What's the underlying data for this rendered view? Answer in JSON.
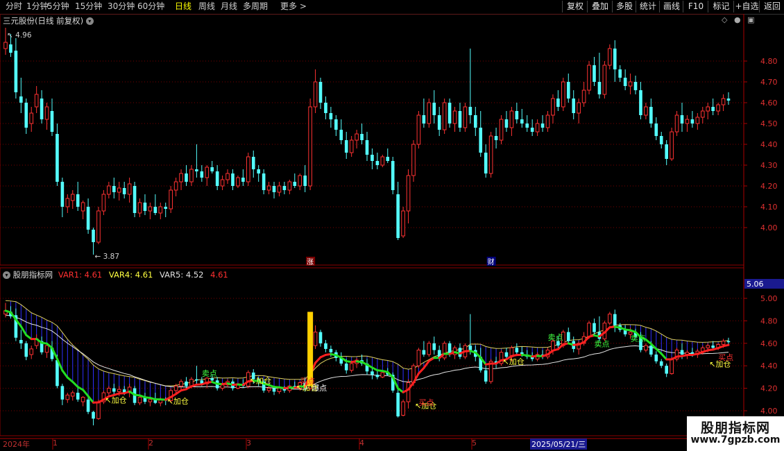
{
  "toolbar": {
    "left_items": [
      "分时",
      "1分钟",
      "5分钟",
      "15分钟",
      "30分钟",
      "60分钟",
      "日线",
      "周线",
      "月线",
      "多周期",
      "更多 >"
    ],
    "selected": "日线",
    "right_items": [
      "复权",
      "叠加",
      "多股",
      "统计",
      "画线",
      "F10",
      "标记",
      "+自选",
      "返回"
    ]
  },
  "main_panel": {
    "title": "三元股份(日线 前复权)",
    "high_marker": "4.96",
    "low_marker": "3.87",
    "y_ticks": [
      "4.80",
      "4.70",
      "4.60",
      "4.50",
      "4.40",
      "4.30",
      "4.20",
      "4.10",
      "4.00"
    ],
    "tags": {
      "zhang": "涨",
      "cai": "财"
    }
  },
  "indicator_panel": {
    "name": "股朋指标网",
    "var1": "VAR1: 4.61",
    "var4": "VAR4: 4.61",
    "var5": "VAR5: 4.52",
    "extra": "4.61",
    "y_ticks": [
      "5.00",
      "4.80",
      "4.60",
      "4.40",
      "4.20",
      "4.00"
    ],
    "current_value": "5.06",
    "signals": {
      "add": "加仓",
      "sell": "卖点",
      "buy": "买点",
      "burst": "爆点"
    }
  },
  "date_axis": {
    "labels": [
      "2024年",
      "1",
      "2",
      "3",
      "4",
      "5"
    ],
    "cursor_date": "2025/05/21/三"
  },
  "watermark": {
    "line1": "股朋指标网",
    "line2": "www.7gpzb.com"
  },
  "colors": {
    "up": "#ff3232",
    "down": "#54ffff",
    "red_line": "#ff2020",
    "green_line": "#22dd22",
    "fill_blue": "#3030ff",
    "grid": "#7a0000"
  },
  "chart_data": {
    "type": "candlestick",
    "ohlc": [
      [
        4.86,
        4.96,
        4.83,
        4.89
      ],
      [
        4.88,
        4.93,
        4.82,
        4.84
      ],
      [
        4.85,
        4.91,
        4.62,
        4.65
      ],
      [
        4.63,
        4.72,
        4.55,
        4.6
      ],
      [
        4.6,
        4.62,
        4.45,
        4.48
      ],
      [
        4.5,
        4.58,
        4.46,
        4.55
      ],
      [
        4.58,
        4.68,
        4.55,
        4.64
      ],
      [
        4.62,
        4.66,
        4.5,
        4.52
      ],
      [
        4.52,
        4.6,
        4.47,
        4.58
      ],
      [
        4.56,
        4.62,
        4.44,
        4.46
      ],
      [
        4.45,
        4.5,
        4.2,
        4.22
      ],
      [
        4.22,
        4.24,
        4.05,
        4.1
      ],
      [
        4.1,
        4.16,
        4.07,
        4.14
      ],
      [
        4.13,
        4.18,
        4.09,
        4.16
      ],
      [
        4.16,
        4.22,
        4.08,
        4.1
      ],
      [
        4.08,
        4.13,
        4.04,
        4.12
      ],
      [
        4.1,
        4.14,
        3.97,
        3.99
      ],
      [
        3.99,
        4.0,
        3.87,
        3.93
      ],
      [
        3.93,
        4.1,
        3.92,
        4.08
      ],
      [
        4.08,
        4.18,
        4.06,
        4.16
      ],
      [
        4.16,
        4.22,
        4.14,
        4.2
      ],
      [
        4.2,
        4.24,
        4.14,
        4.17
      ],
      [
        4.17,
        4.22,
        4.13,
        4.19
      ],
      [
        4.19,
        4.22,
        4.14,
        4.16
      ],
      [
        4.16,
        4.24,
        4.12,
        4.21
      ],
      [
        4.2,
        4.22,
        4.05,
        4.07
      ],
      [
        4.07,
        4.14,
        4.05,
        4.12
      ],
      [
        4.12,
        4.16,
        4.06,
        4.08
      ],
      [
        4.08,
        4.12,
        4.04,
        4.1
      ],
      [
        4.1,
        4.16,
        4.06,
        4.07
      ],
      [
        4.07,
        4.12,
        4.04,
        4.1
      ],
      [
        4.1,
        4.12,
        4.05,
        4.09
      ],
      [
        4.09,
        4.2,
        4.07,
        4.18
      ],
      [
        4.18,
        4.24,
        4.15,
        4.22
      ],
      [
        4.22,
        4.28,
        4.18,
        4.26
      ],
      [
        4.26,
        4.3,
        4.2,
        4.22
      ],
      [
        4.22,
        4.3,
        4.2,
        4.28
      ],
      [
        4.28,
        4.4,
        4.24,
        4.27
      ],
      [
        4.27,
        4.3,
        4.22,
        4.24
      ],
      [
        4.24,
        4.3,
        4.2,
        4.29
      ],
      [
        4.29,
        4.32,
        4.26,
        4.27
      ],
      [
        4.27,
        4.3,
        4.18,
        4.2
      ],
      [
        4.2,
        4.25,
        4.18,
        4.23
      ],
      [
        4.23,
        4.28,
        4.21,
        4.26
      ],
      [
        4.26,
        4.28,
        4.18,
        4.2
      ],
      [
        4.2,
        4.25,
        4.19,
        4.24
      ],
      [
        4.24,
        4.28,
        4.2,
        4.22
      ],
      [
        4.22,
        4.36,
        4.2,
        4.34
      ],
      [
        4.34,
        4.37,
        4.24,
        4.28
      ],
      [
        4.28,
        4.3,
        4.22,
        4.26
      ],
      [
        4.26,
        4.28,
        4.16,
        4.18
      ],
      [
        4.18,
        4.22,
        4.16,
        4.2
      ],
      [
        4.2,
        4.22,
        4.14,
        4.17
      ],
      [
        4.17,
        4.22,
        4.15,
        4.2
      ],
      [
        4.2,
        4.22,
        4.16,
        4.18
      ],
      [
        4.18,
        4.23,
        4.16,
        4.22
      ],
      [
        4.22,
        4.26,
        4.19,
        4.2
      ],
      [
        4.2,
        4.26,
        4.18,
        4.25
      ],
      [
        4.25,
        4.3,
        4.17,
        4.2
      ],
      [
        4.2,
        4.62,
        4.18,
        4.58
      ],
      [
        4.58,
        4.76,
        4.55,
        4.7
      ],
      [
        4.7,
        4.72,
        4.57,
        4.6
      ],
      [
        4.6,
        4.63,
        4.52,
        4.55
      ],
      [
        4.55,
        4.58,
        4.48,
        4.52
      ],
      [
        4.52,
        4.54,
        4.44,
        4.47
      ],
      [
        4.47,
        4.52,
        4.4,
        4.42
      ],
      [
        4.42,
        4.46,
        4.33,
        4.36
      ],
      [
        4.36,
        4.44,
        4.34,
        4.42
      ],
      [
        4.42,
        4.47,
        4.38,
        4.45
      ],
      [
        4.45,
        4.5,
        4.4,
        4.42
      ],
      [
        4.42,
        4.46,
        4.32,
        4.35
      ],
      [
        4.35,
        4.38,
        4.28,
        4.32
      ],
      [
        4.32,
        4.36,
        4.28,
        4.3
      ],
      [
        4.3,
        4.35,
        4.29,
        4.34
      ],
      [
        4.34,
        4.38,
        4.31,
        4.32
      ],
      [
        4.32,
        4.34,
        4.16,
        4.18
      ],
      [
        4.16,
        4.22,
        3.94,
        3.95
      ],
      [
        3.96,
        4.1,
        3.95,
        4.08
      ],
      [
        4.08,
        4.28,
        4.02,
        4.25
      ],
      [
        4.25,
        4.42,
        4.22,
        4.4
      ],
      [
        4.4,
        4.56,
        4.38,
        4.54
      ],
      [
        4.54,
        4.62,
        4.48,
        4.5
      ],
      [
        4.5,
        4.62,
        4.48,
        4.6
      ],
      [
        4.6,
        4.66,
        4.5,
        4.54
      ],
      [
        4.54,
        4.58,
        4.44,
        4.47
      ],
      [
        4.47,
        4.62,
        4.45,
        4.6
      ],
      [
        4.6,
        4.62,
        4.48,
        4.5
      ],
      [
        4.5,
        4.58,
        4.46,
        4.56
      ],
      [
        4.56,
        4.6,
        4.46,
        4.48
      ],
      [
        4.48,
        4.6,
        4.46,
        4.58
      ],
      [
        4.58,
        4.86,
        4.5,
        4.54
      ],
      [
        4.54,
        4.58,
        4.44,
        4.48
      ],
      [
        4.48,
        4.56,
        4.34,
        4.36
      ],
      [
        4.36,
        4.4,
        4.24,
        4.26
      ],
      [
        4.26,
        4.46,
        4.24,
        4.44
      ],
      [
        4.44,
        4.48,
        4.38,
        4.42
      ],
      [
        4.42,
        4.54,
        4.4,
        4.52
      ],
      [
        4.52,
        4.56,
        4.46,
        4.48
      ],
      [
        4.48,
        4.58,
        4.44,
        4.56
      ],
      [
        4.56,
        4.6,
        4.5,
        4.52
      ],
      [
        4.52,
        4.57,
        4.48,
        4.5
      ],
      [
        4.5,
        4.54,
        4.46,
        4.48
      ],
      [
        4.48,
        4.52,
        4.44,
        4.46
      ],
      [
        4.46,
        4.52,
        4.44,
        4.5
      ],
      [
        4.5,
        4.54,
        4.46,
        4.48
      ],
      [
        4.48,
        4.56,
        4.46,
        4.54
      ],
      [
        4.54,
        4.64,
        4.5,
        4.62
      ],
      [
        4.62,
        4.66,
        4.56,
        4.58
      ],
      [
        4.58,
        4.72,
        4.56,
        4.7
      ],
      [
        4.7,
        4.74,
        4.6,
        4.62
      ],
      [
        4.62,
        4.66,
        4.52,
        4.55
      ],
      [
        4.55,
        4.62,
        4.5,
        4.6
      ],
      [
        4.6,
        4.7,
        4.58,
        4.66
      ],
      [
        4.66,
        4.8,
        4.64,
        4.78
      ],
      [
        4.78,
        4.82,
        4.68,
        4.7
      ],
      [
        4.7,
        4.84,
        4.62,
        4.64
      ],
      [
        4.64,
        4.8,
        4.62,
        4.78
      ],
      [
        4.78,
        4.88,
        4.76,
        4.86
      ],
      [
        4.86,
        4.9,
        4.7,
        4.76
      ],
      [
        4.76,
        4.78,
        4.7,
        4.72
      ],
      [
        4.72,
        4.76,
        4.66,
        4.68
      ],
      [
        4.68,
        4.74,
        4.64,
        4.7
      ],
      [
        4.7,
        4.73,
        4.64,
        4.66
      ],
      [
        4.66,
        4.7,
        4.52,
        4.54
      ],
      [
        4.54,
        4.6,
        4.52,
        4.58
      ],
      [
        4.58,
        4.62,
        4.48,
        4.5
      ],
      [
        4.5,
        4.53,
        4.42,
        4.44
      ],
      [
        4.44,
        4.46,
        4.38,
        4.4
      ],
      [
        4.4,
        4.42,
        4.3,
        4.33
      ],
      [
        4.33,
        4.48,
        4.32,
        4.46
      ],
      [
        4.46,
        4.56,
        4.44,
        4.54
      ],
      [
        4.54,
        4.6,
        4.46,
        4.5
      ],
      [
        4.5,
        4.54,
        4.46,
        4.52
      ],
      [
        4.52,
        4.56,
        4.48,
        4.5
      ],
      [
        4.5,
        4.55,
        4.47,
        4.53
      ],
      [
        4.53,
        4.58,
        4.5,
        4.56
      ],
      [
        4.56,
        4.6,
        4.52,
        4.58
      ],
      [
        4.58,
        4.62,
        4.54,
        4.56
      ],
      [
        4.56,
        4.6,
        4.54,
        4.59
      ],
      [
        4.59,
        4.64,
        4.56,
        4.62
      ],
      [
        4.62,
        4.65,
        4.59,
        4.61
      ]
    ]
  }
}
